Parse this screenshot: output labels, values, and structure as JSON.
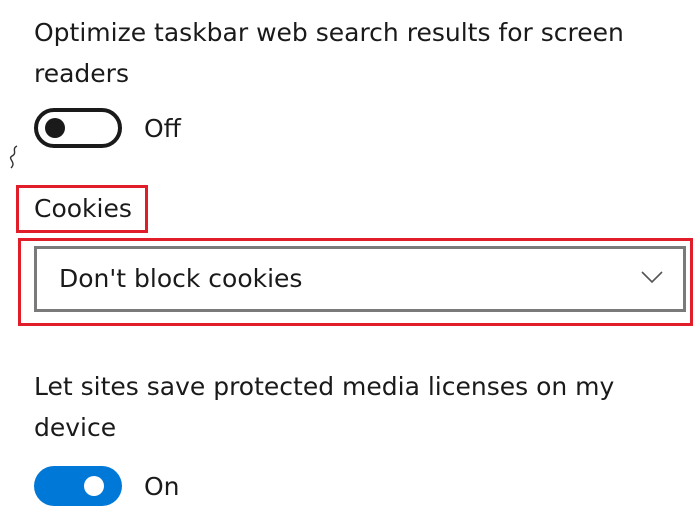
{
  "settings": {
    "web_search": {
      "title": "Optimize taskbar web search results for screen readers",
      "state_label": "Off",
      "enabled": false
    },
    "cookies": {
      "label": "Cookies",
      "selected": "Don't block cookies",
      "icon": "chevron-down-icon"
    },
    "media_licenses": {
      "title": "Let sites save protected media licenses on my device",
      "state_label": "On",
      "enabled": true
    }
  },
  "colors": {
    "accent": "#0078d7",
    "highlight": "#e11d2a",
    "text": "#1a1a1a",
    "dropdown_border": "#7a7a7a"
  }
}
